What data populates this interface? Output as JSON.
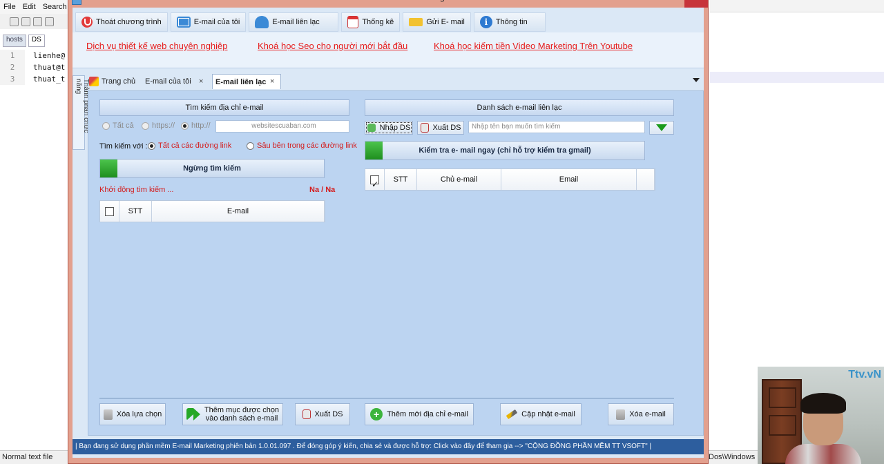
{
  "background_editor": {
    "menu": [
      "File",
      "Edit",
      "Search"
    ],
    "tabs": [
      "hosts",
      "DS"
    ],
    "lines": [
      {
        "num": "1",
        "text": "lienhe@"
      },
      {
        "num": "2",
        "text": "thuat@t"
      },
      {
        "num": "3",
        "text": "thuat_t"
      }
    ],
    "status": "Normal text file"
  },
  "background_right": {
    "status": "Dos\\Windows"
  },
  "webcam": {
    "logo": "Ttv.vN"
  },
  "window": {
    "title": "Phần mềm E-mail Marketing",
    "ribbon": [
      {
        "label": "Thoát chương trình",
        "icon": "power-icon"
      },
      {
        "label": "E-mail của tôi",
        "icon": "mail-icon"
      },
      {
        "label": "E-mail liên lạc",
        "icon": "contacts-icon"
      },
      {
        "label": "Thống kê",
        "icon": "calendar-icon"
      },
      {
        "label": "Gửi E- mail",
        "icon": "send-mail-icon"
      },
      {
        "label": "Thông tin",
        "icon": "info-icon"
      }
    ],
    "links": [
      "Dịch vụ thiết kế web chuyên nghiệp",
      "Khoá học Seo cho người mới bắt đầu",
      "Khoá học kiếm tiền  Video Marketing Trên Youtube"
    ],
    "side_tab": "Thành phần chức năng",
    "tabs": {
      "home": "Trang chủ",
      "my_email": "E-mail của tôi",
      "contacts": "E-mail liên lạc",
      "close": "×"
    },
    "search": {
      "header": "Tìm kiếm địa chỉ e-mail",
      "radio_all": "Tất cả",
      "radio_https": "https://",
      "radio_http": "http://",
      "url_value": "websitescuaban.com",
      "search_with_label": "Tìm kiếm với :",
      "opt_all_links": "Tất cả các đường link",
      "opt_deep_links": "Sâu bên trong các đường link",
      "stop_button": "Ngừng tìm kiếm",
      "status_text": "Khởi động tìm kiếm ...",
      "counter": "Na / Na",
      "table_headers": [
        "STT",
        "E-mail"
      ]
    },
    "contact_list": {
      "header": "Danh sách e-mail liên lạc",
      "import_button": "Nhập DS",
      "export_button": "Xuất DS",
      "search_placeholder": "Nhập tên bạn muốn tìm kiếm",
      "check_button": "Kiểm tra e- mail ngay (chỉ hỗ trợ kiểm tra gmail)",
      "table_headers": [
        "STT",
        "Chủ e-mail",
        "Email"
      ]
    },
    "bottom_buttons": {
      "delete_selected": "Xóa lựa chọn",
      "add_to_list_line1": "Thêm mục được chọn",
      "add_to_list_line2": "vào danh sách e-mail",
      "export": "Xuất DS",
      "add_new": "Thêm mới địa chỉ e-mail",
      "update": "Cập nhật  e-mail",
      "delete": "Xóa e-mail"
    },
    "status_bar": "| Bạn đang sử dụng phần mềm E-mail Marketing phiên bản 1.0.01.097 . Để đóng góp ý kiến, chia sẻ và được hỗ trợ: Click vào đây để tham gia --> \"CỘNG ĐỒNG PHẦN MỀM TT VSOFT\" |"
  }
}
